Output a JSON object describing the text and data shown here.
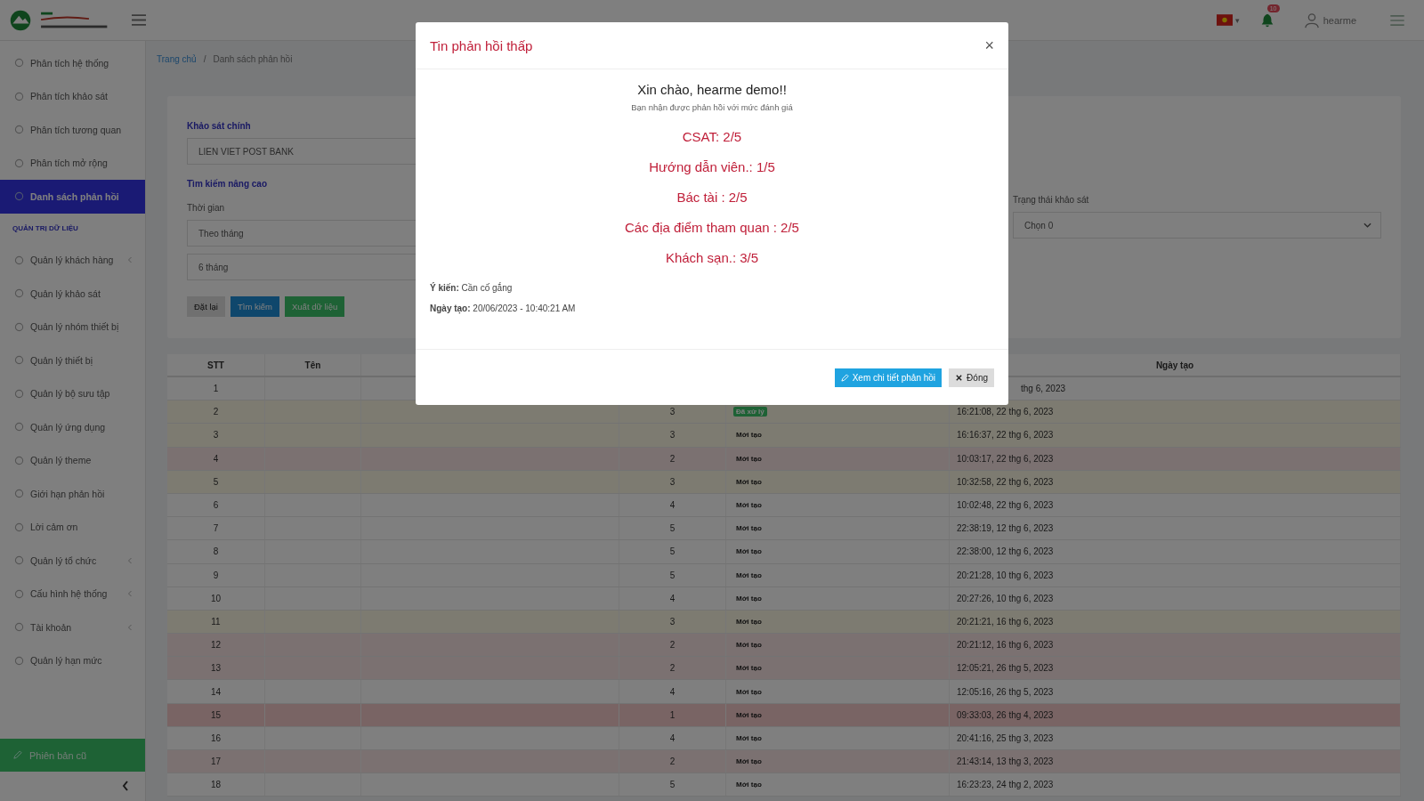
{
  "header": {
    "user": "hearme",
    "notification_count": "10",
    "language_caret": "▾"
  },
  "sidebar": {
    "items": [
      {
        "label": "Phân tích hệ thống",
        "selected": false
      },
      {
        "label": "Phân tích khảo sát",
        "selected": false
      },
      {
        "label": "Phân tích tương quan",
        "selected": false
      },
      {
        "label": "Phân tích mở rộng",
        "selected": false
      },
      {
        "label": "Danh sách phản hồi",
        "selected": true
      },
      {
        "kind": "section",
        "label": "QUẢN TRỊ DỮ LIỆU"
      },
      {
        "label": "Quản lý khách hàng",
        "selected": false,
        "expandable": true
      },
      {
        "label": "Quản lý khảo sát",
        "selected": false
      },
      {
        "label": "Quản lý nhóm thiết bị",
        "selected": false
      },
      {
        "label": "Quản lý thiết bị",
        "selected": false
      },
      {
        "label": "Quản lý bộ sưu tập",
        "selected": false
      },
      {
        "label": "Quản lý ứng dụng",
        "selected": false
      },
      {
        "label": "Quản lý theme",
        "selected": false
      },
      {
        "label": "Giới hạn phản hồi",
        "selected": false
      },
      {
        "label": "Lời cảm ơn",
        "selected": false
      },
      {
        "label": "Quản lý tổ chức",
        "selected": false,
        "expandable": true
      },
      {
        "label": "Cấu hình hệ thống",
        "selected": false,
        "expandable": true
      },
      {
        "label": "Tài khoản",
        "selected": false,
        "expandable": true
      },
      {
        "label": "Quản lý hạn mức",
        "selected": false
      }
    ],
    "bottom_button": "Phiên bản cũ"
  },
  "breadcrumb": {
    "items": [
      "Trang chủ",
      "Danh sách phản hồi"
    ],
    "separator": "/"
  },
  "filters": {
    "survey_label": "Khảo sát chính",
    "survey_value": "LIEN VIET POST BANK",
    "advanced_label": "Tìm kiếm nâng cao",
    "time_label": "Thời gian",
    "time_value": "Theo tháng",
    "range_value": "6 tháng",
    "status_label": "Trạng thái khảo sát",
    "status_value": "Chọn 0",
    "buttons": [
      "Đặt lại",
      "Tìm kiếm",
      "Xuất dữ liệu"
    ]
  },
  "table": {
    "columns": [
      "STT",
      "Tên",
      "Ngày tạo"
    ],
    "rows": [
      {
        "stt": "1",
        "date": "thg 6, 2023"
      },
      {
        "stt": "2",
        "rating": "3",
        "status": "Đã xử lý",
        "badge": true,
        "date": "16:21:08, 22 thg 6, 2023",
        "color": "#7d7b71"
      },
      {
        "stt": "3",
        "rating": "3",
        "status": "Mới tạo",
        "badge": false,
        "date": "16:16:37, 22 thg 6, 2023",
        "color": "#7d7b71"
      },
      {
        "stt": "4",
        "rating": "2",
        "status": "Mới tạo",
        "badge": false,
        "date": "10:03:17, 22 thg 6, 2023",
        "color": "#7b7171"
      },
      {
        "stt": "5",
        "rating": "3",
        "status": "Mới tạo",
        "badge": false,
        "date": "10:32:58, 22 thg 6, 2023",
        "color": "#7d7b71"
      },
      {
        "stt": "6",
        "rating": "4",
        "status": "Mới tạo",
        "badge": false,
        "date": "10:02:48, 22 thg 6, 2023"
      },
      {
        "stt": "7",
        "rating": "5",
        "status": "Mới tạo",
        "badge": false,
        "date": "22:38:19, 12 thg 6, 2023"
      },
      {
        "stt": "8",
        "rating": "5",
        "status": "Mới tạo",
        "badge": false,
        "date": "22:38:00, 12 thg 6, 2023"
      },
      {
        "stt": "9",
        "rating": "5",
        "status": "Mới tạo",
        "badge": false,
        "date": "20:21:28, 10 thg 6, 2023"
      },
      {
        "stt": "10",
        "rating": "4",
        "status": "Mới tạo",
        "badge": false,
        "date": "20:27:26, 10 thg 6, 2023"
      },
      {
        "stt": "11",
        "rating": "3",
        "status": "Mới tạo",
        "badge": false,
        "date": "20:21:21, 16 thg 6, 2023",
        "color": "#7d7b71"
      },
      {
        "stt": "12",
        "rating": "2",
        "status": "Mới tạo",
        "badge": false,
        "date": "20:21:12, 16 thg 6, 2023",
        "color": "#7b7171"
      },
      {
        "stt": "13",
        "rating": "2",
        "status": "Mới tạo",
        "badge": false,
        "date": "12:05:21, 26 thg 5, 2023",
        "color": "#7b7171"
      },
      {
        "stt": "14",
        "rating": "4",
        "status": "Mới tạo",
        "badge": false,
        "date": "12:05:16, 26 thg 5, 2023"
      },
      {
        "stt": "15",
        "rating": "1",
        "status": "Mới tạo",
        "badge": false,
        "date": "09:33:03, 26 thg 4, 2023",
        "color": "#796464"
      },
      {
        "stt": "16",
        "rating": "4",
        "status": "Mới tạo",
        "badge": false,
        "date": "20:41:16, 25 thg 3, 2023"
      },
      {
        "stt": "17",
        "rating": "2",
        "status": "Mới tạo",
        "badge": false,
        "date": "21:43:14, 13 thg 3, 2023",
        "color": "#7b7171"
      },
      {
        "stt": "18",
        "rating": "5",
        "status": "Mới tạo",
        "badge": false,
        "date": "16:23:23, 24 thg 2, 2023"
      }
    ]
  },
  "modal": {
    "title": "Tin phản hồi thấp",
    "close": "×",
    "greeting": "Xin chào, hearme demo!!",
    "subtitle": "Bạn nhận được phản hồi với mức đánh giá",
    "scores": [
      "CSAT: 2/5",
      "Hướng dẫn viên.: 1/5",
      "Bác tài : 2/5",
      "Các địa điểm tham quan : 2/5",
      "Khách sạn.: 3/5"
    ],
    "comment": "**Ý kiến:** Cần cố gắng",
    "created": "**Ngày tạo:** 20/06/2023 - 10:40:21 AM",
    "buttons": [
      {
        "label": "Xem chi tiết phản hồi",
        "kind": "primary"
      },
      {
        "label": "Đóng",
        "kind": "secondary"
      }
    ]
  }
}
